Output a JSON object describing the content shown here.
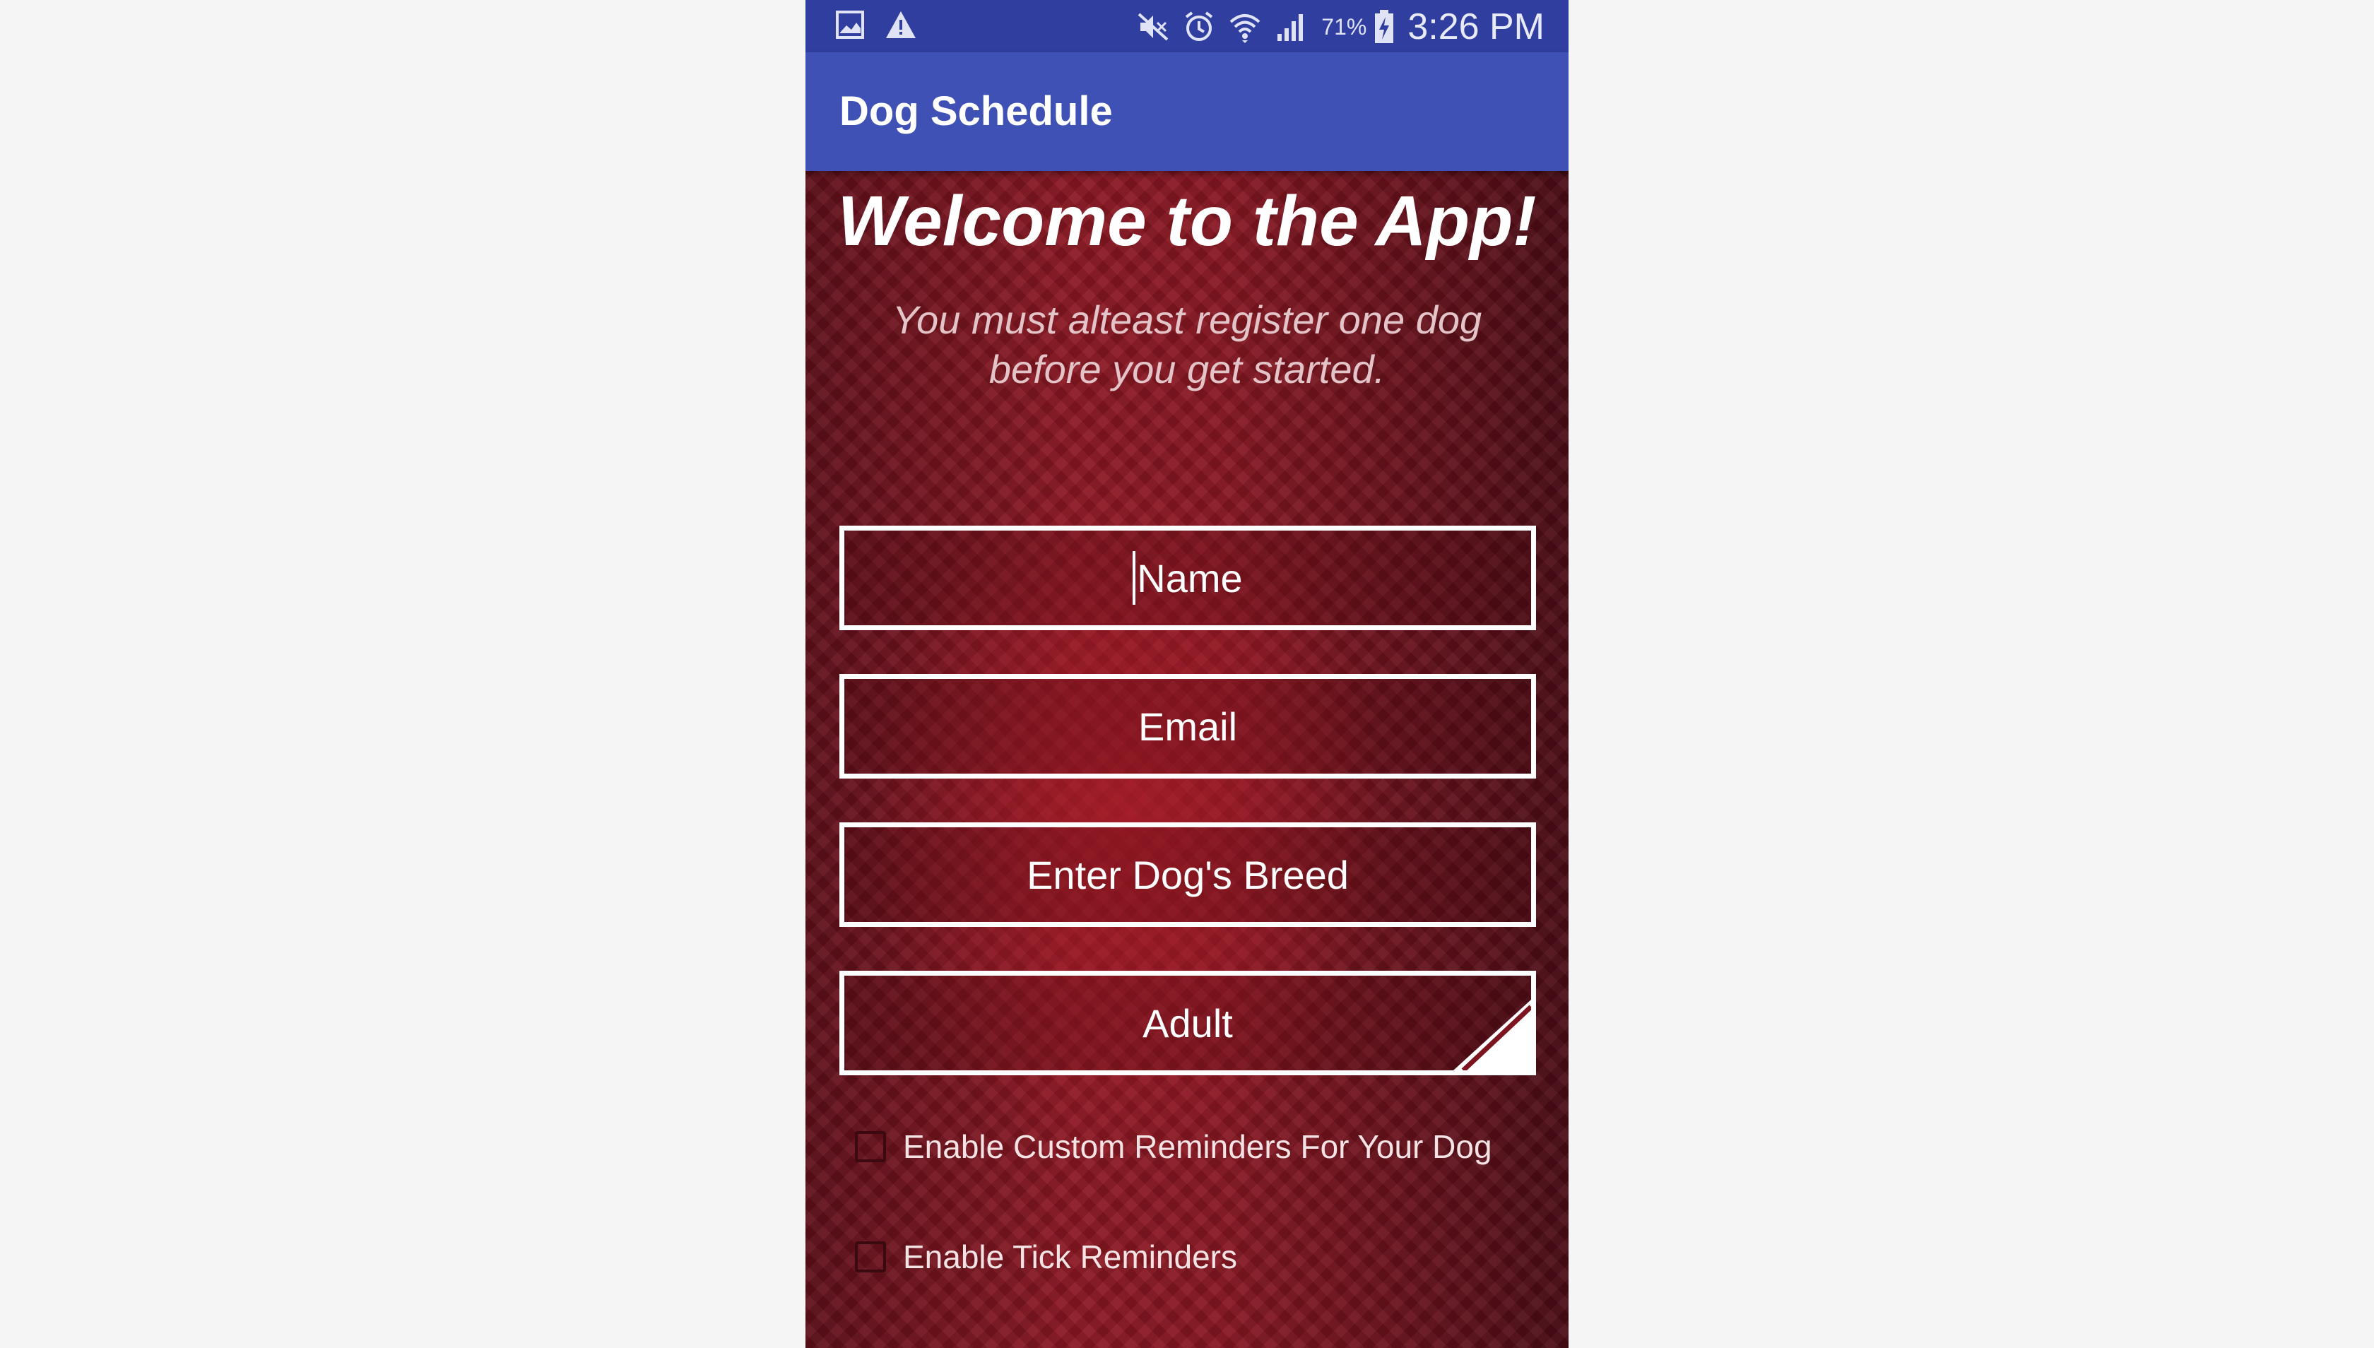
{
  "status_bar": {
    "left_icons": [
      "gallery-icon",
      "warning-icon"
    ],
    "right_icons": [
      "mute-icon",
      "alarm-icon",
      "wifi-icon",
      "signal-icon",
      "battery-charging-icon"
    ],
    "battery_percent": "71%",
    "time": "3:26 PM"
  },
  "app_bar": {
    "title": "Dog Schedule",
    "color": "#3f51b5"
  },
  "main": {
    "welcome": "Welcome to the App!",
    "subtitle": "You must alteast register one dog before you get started.",
    "fields": {
      "name_placeholder": "Name",
      "email_placeholder": "Email",
      "breed_placeholder": "Enter Dog's Breed"
    },
    "age_select": {
      "selected": "Adult"
    },
    "checkboxes": {
      "custom_reminders": {
        "label": "Enable Custom Reminders For Your Dog",
        "checked": false
      },
      "tick_reminders": {
        "label": "Enable Tick Reminders",
        "checked": false
      }
    }
  },
  "colors": {
    "status_bar": "#303f9f",
    "background": "#7d1520",
    "field_border": "#ffffff"
  }
}
